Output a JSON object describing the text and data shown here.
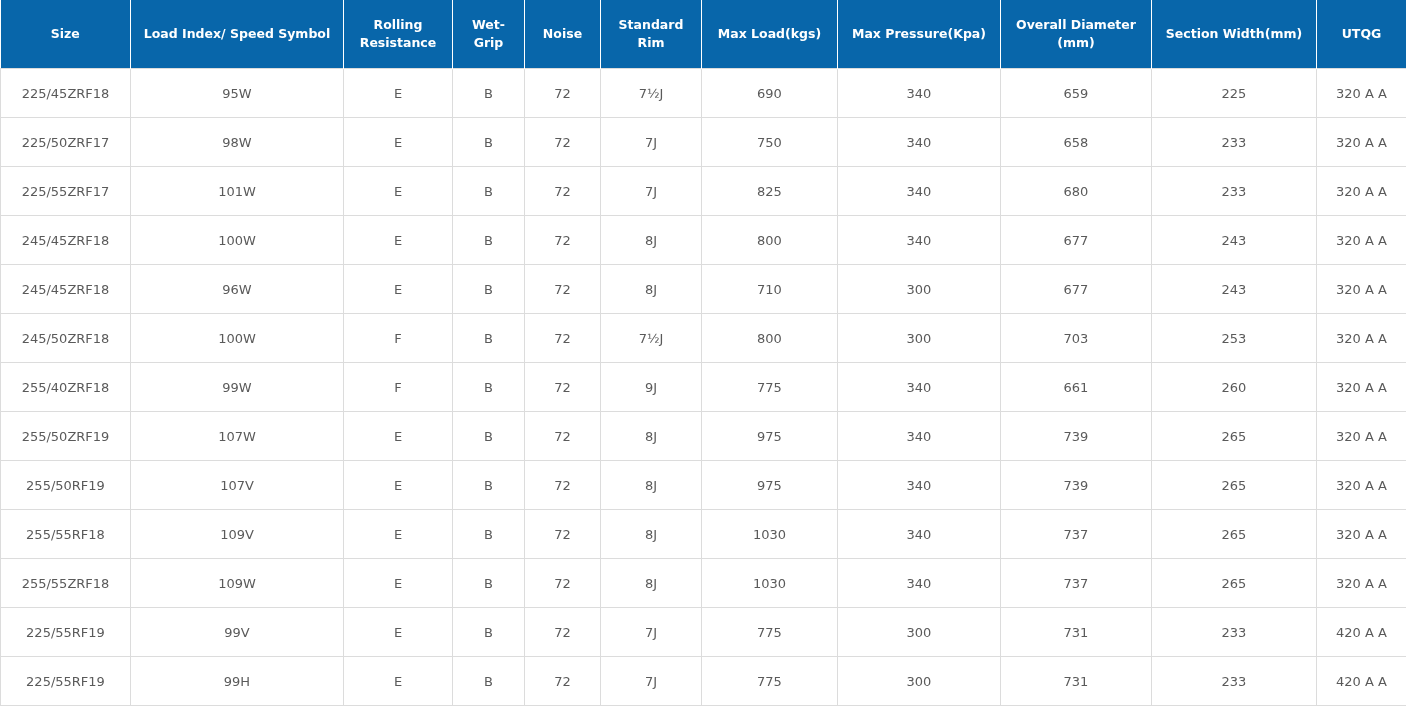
{
  "table": {
    "columns": [
      "Size",
      "Load Index/ Speed Symbol",
      "Rolling Resistance",
      "Wet-Grip",
      "Noise",
      "Standard Rim",
      "Max Load(kgs)",
      "Max Pressure(Kpa)",
      "Overall Diameter (mm)",
      "Section Width(mm)",
      "UTQG"
    ],
    "rows": [
      [
        "225/45ZRF18",
        "95W",
        "E",
        "B",
        "72",
        "7½J",
        "690",
        "340",
        "659",
        "225",
        "320 A A"
      ],
      [
        "225/50ZRF17",
        "98W",
        "E",
        "B",
        "72",
        "7J",
        "750",
        "340",
        "658",
        "233",
        "320 A A"
      ],
      [
        "225/55ZRF17",
        "101W",
        "E",
        "B",
        "72",
        "7J",
        "825",
        "340",
        "680",
        "233",
        "320 A A"
      ],
      [
        "245/45ZRF18",
        "100W",
        "E",
        "B",
        "72",
        "8J",
        "800",
        "340",
        "677",
        "243",
        "320 A A"
      ],
      [
        "245/45ZRF18",
        "96W",
        "E",
        "B",
        "72",
        "8J",
        "710",
        "300",
        "677",
        "243",
        "320 A A"
      ],
      [
        "245/50ZRF18",
        "100W",
        "F",
        "B",
        "72",
        "7½J",
        "800",
        "300",
        "703",
        "253",
        "320 A A"
      ],
      [
        "255/40ZRF18",
        "99W",
        "F",
        "B",
        "72",
        "9J",
        "775",
        "340",
        "661",
        "260",
        "320 A A"
      ],
      [
        "255/50ZRF19",
        "107W",
        "E",
        "B",
        "72",
        "8J",
        "975",
        "340",
        "739",
        "265",
        "320 A A"
      ],
      [
        "255/50RF19",
        "107V",
        "E",
        "B",
        "72",
        "8J",
        "975",
        "340",
        "739",
        "265",
        "320 A A"
      ],
      [
        "255/55RF18",
        "109V",
        "E",
        "B",
        "72",
        "8J",
        "1030",
        "340",
        "737",
        "265",
        "320 A A"
      ],
      [
        "255/55ZRF18",
        "109W",
        "E",
        "B",
        "72",
        "8J",
        "1030",
        "340",
        "737",
        "265",
        "320 A A"
      ],
      [
        "225/55RF19",
        "99V",
        "E",
        "B",
        "72",
        "7J",
        "775",
        "300",
        "731",
        "233",
        "420 A A"
      ],
      [
        "225/55RF19",
        "99H",
        "E",
        "B",
        "72",
        "7J",
        "775",
        "300",
        "731",
        "233",
        "420 A A"
      ]
    ]
  }
}
